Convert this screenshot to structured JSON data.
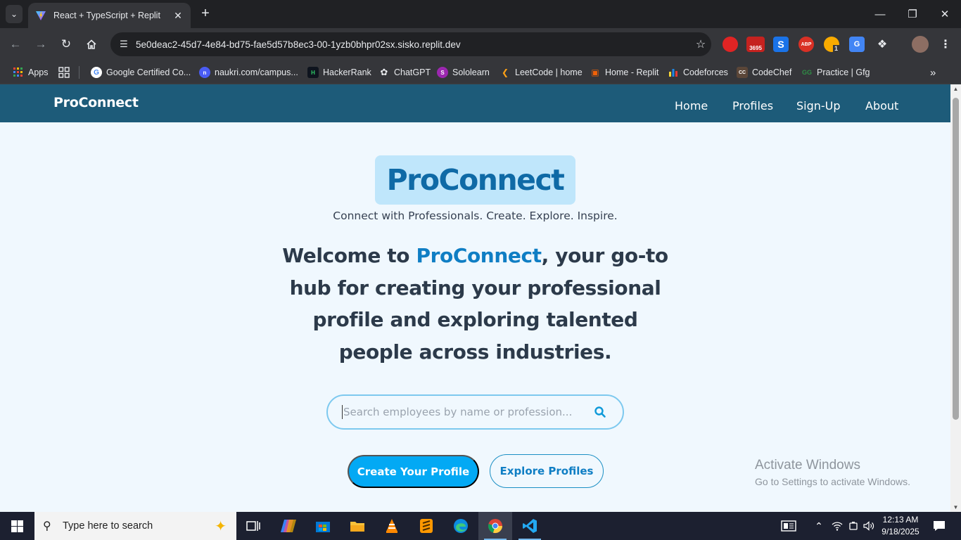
{
  "browser": {
    "tab_title": "React + TypeScript + Replit",
    "url": "5e0deac2-45d7-4e84-bd75-fae5d57b8ec3-00-1yzb0bhpr02sx.sisko.replit.dev",
    "extension_badge": "3695",
    "extension_count": "1",
    "adblock_label": "ABP",
    "bookmarks": [
      {
        "label": "Apps",
        "icon": "apps-grid-icon"
      },
      {
        "label": "Google Certified Co...",
        "icon": "google-icon"
      },
      {
        "label": "naukri.com/campus...",
        "icon": "naukri-icon"
      },
      {
        "label": "HackerRank",
        "icon": "hackerrank-icon"
      },
      {
        "label": "ChatGPT",
        "icon": "chatgpt-icon"
      },
      {
        "label": "Sololearn",
        "icon": "sololearn-icon"
      },
      {
        "label": "LeetCode | home",
        "icon": "leetcode-icon"
      },
      {
        "label": "Home - Replit",
        "icon": "replit-icon"
      },
      {
        "label": "Codeforces",
        "icon": "codeforces-icon"
      },
      {
        "label": "CodeChef",
        "icon": "codechef-icon"
      },
      {
        "label": "Practice | Gfg",
        "icon": "gfg-icon"
      }
    ]
  },
  "site": {
    "brand": "ProConnect",
    "nav": [
      "Home",
      "Profiles",
      "Sign-Up",
      "About"
    ],
    "hero_title": "ProConnect",
    "tagline": "Connect with Professionals. Create. Explore. Inspire.",
    "welcome_prefix": "Welcome to ",
    "welcome_accent": "ProConnect",
    "welcome_suffix": ", your go-to hub for creating your professional profile and exploring talented people across industries.",
    "search_placeholder": "Search employees by name or profession...",
    "primary_button": "Create Your Profile",
    "secondary_button": "Explore Profiles",
    "colors": {
      "header": "#1d5b79",
      "accent": "#0f7ec4",
      "primary_button": "#03a9f4",
      "background": "#f0f8fe"
    }
  },
  "watermark": {
    "line1": "Activate Windows",
    "line2": "Go to Settings to activate Windows."
  },
  "taskbar": {
    "search_placeholder": "Type here to search",
    "time": "12:13 AM",
    "date": "9/18/2025"
  }
}
